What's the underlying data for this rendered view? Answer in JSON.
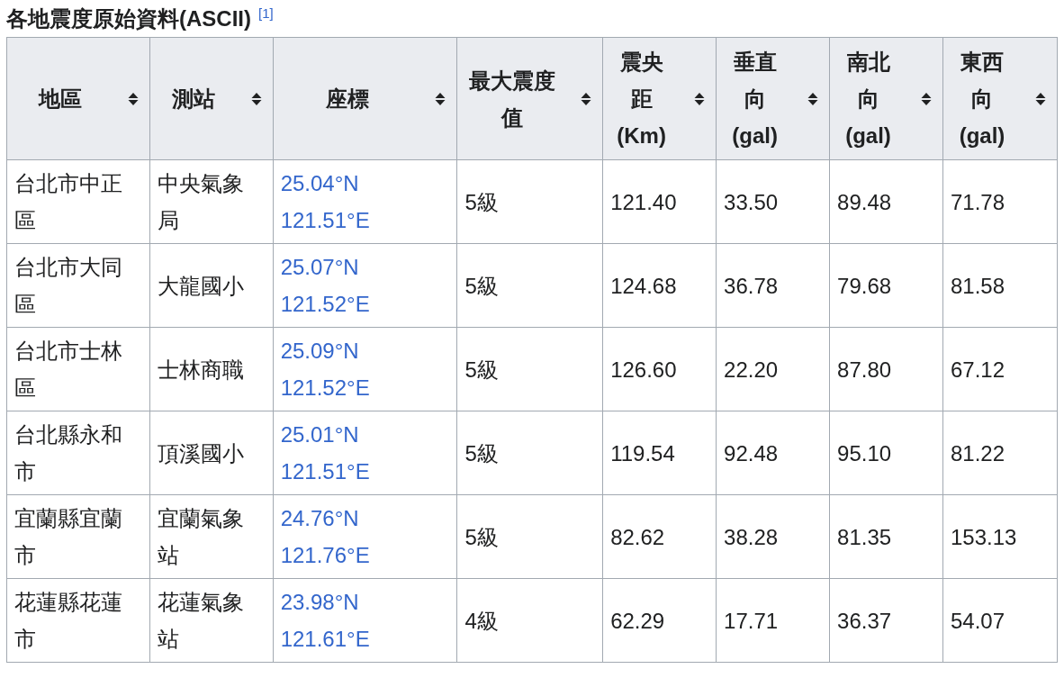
{
  "title": "各地震度原始資料(ASCII)",
  "footnote": "[1]",
  "table": {
    "columns": [
      "地區",
      "測站",
      "座標",
      "最大震度值",
      "震央距(Km)",
      "垂直向(gal)",
      "南北向(gal)",
      "東西向(gal)"
    ],
    "rows": [
      {
        "area": "台北市中正區",
        "station": "中央氣象局",
        "lat": "25.04°N",
        "lon": "121.51°E",
        "intensity": "5級",
        "distance": "121.40",
        "vertical": "33.50",
        "ns": "89.48",
        "ew": "71.78"
      },
      {
        "area": "台北市大同區",
        "station": "大龍國小",
        "lat": "25.07°N",
        "lon": "121.52°E",
        "intensity": "5級",
        "distance": "124.68",
        "vertical": "36.78",
        "ns": "79.68",
        "ew": "81.58"
      },
      {
        "area": "台北市士林區",
        "station": "士林商職",
        "lat": "25.09°N",
        "lon": "121.52°E",
        "intensity": "5級",
        "distance": "126.60",
        "vertical": "22.20",
        "ns": "87.80",
        "ew": "67.12"
      },
      {
        "area": "台北縣永和市",
        "station": "頂溪國小",
        "lat": "25.01°N",
        "lon": "121.51°E",
        "intensity": "5級",
        "distance": "119.54",
        "vertical": "92.48",
        "ns": "95.10",
        "ew": "81.22"
      },
      {
        "area": "宜蘭縣宜蘭市",
        "station": "宜蘭氣象站",
        "lat": "24.76°N",
        "lon": "121.76°E",
        "intensity": "5級",
        "distance": "82.62",
        "vertical": "38.28",
        "ns": "81.35",
        "ew": "153.13"
      },
      {
        "area": "花蓮縣花蓮市",
        "station": "花蓮氣象站",
        "lat": "23.98°N",
        "lon": "121.61°E",
        "intensity": "4級",
        "distance": "62.29",
        "vertical": "17.71",
        "ns": "36.37",
        "ew": "54.07"
      }
    ]
  }
}
